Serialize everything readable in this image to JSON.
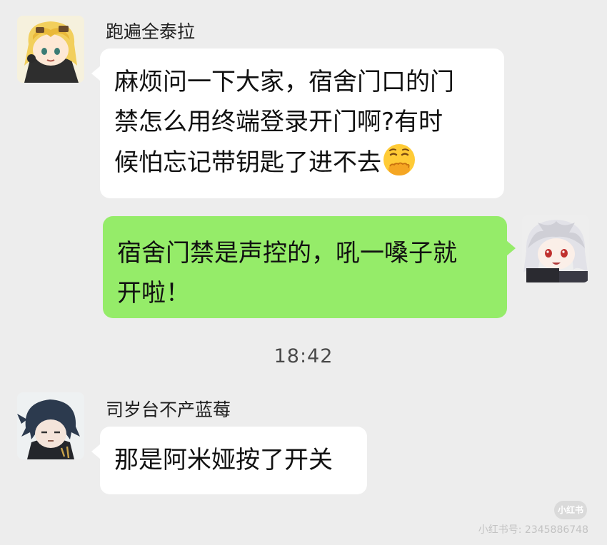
{
  "messages": [
    {
      "sender": "跑遍全泰拉",
      "lines": [
        "麻烦问一下大家，宿舍门口的门",
        "禁怎么用终端登录开门啊?有时",
        "候怕忘记带钥匙了进不去"
      ],
      "emoji": "face-with-hand-over-mouth-emoji"
    },
    {
      "sender": "",
      "lines": [
        "宿舍门禁是声控的，吼一嗓子就",
        "开啦！"
      ]
    },
    {
      "sender": "司岁台不产蓝莓",
      "lines": [
        "那是阿米娅按了开关"
      ]
    }
  ],
  "timestamp": "18:42",
  "watermark": {
    "badge": "小红书",
    "text": "小红书号: 2345886748"
  },
  "colors": {
    "background": "#ededed",
    "incoming_bubble": "#ffffff",
    "outgoing_bubble": "#95ec69"
  }
}
